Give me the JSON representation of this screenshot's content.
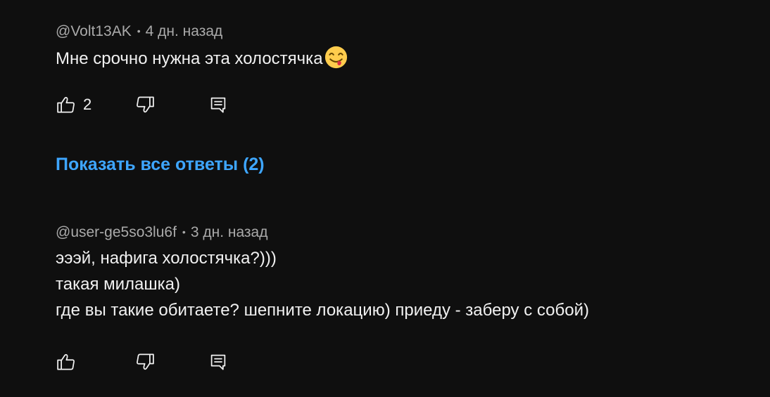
{
  "comments": [
    {
      "author": "@Volt13AK",
      "separator": "•",
      "time": "4 дн. назад",
      "lines": [
        "Мне срочно нужна эта холостячка"
      ],
      "emoji": "yum-face-emoji",
      "likes": "2"
    },
    {
      "author": "@user-ge5so3lu6f",
      "separator": "•",
      "time": "3 дн. назад",
      "lines": [
        "эээй, нафига холостячка?)))",
        "такая милашка)",
        "где вы такие обитаете? шепните локацию) приеду - заберу с собой)"
      ],
      "likes": ""
    }
  ],
  "show_replies_label": "Показать все ответы (2)",
  "colors": {
    "background": "#0f0f0f",
    "link": "#3ea6ff",
    "meta": "#aaaaaa",
    "text": "#f1f1f1"
  },
  "icons": [
    "thumb-up-icon",
    "thumb-down-icon",
    "reply-icon"
  ]
}
